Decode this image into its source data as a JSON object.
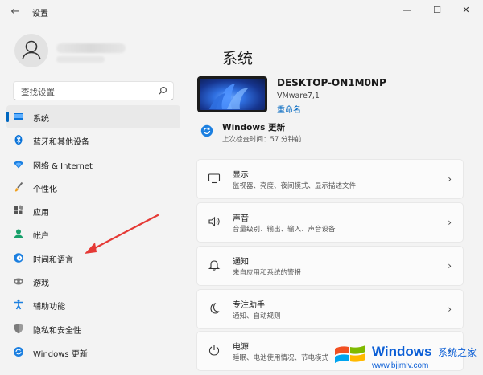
{
  "window": {
    "back_glyph": "←",
    "title": "设置",
    "controls": [
      "—",
      "☐",
      "✕"
    ]
  },
  "search": {
    "placeholder": "查找设置"
  },
  "sidebar": {
    "items": [
      {
        "label": "系统",
        "icon": "monitor-icon",
        "active": true
      },
      {
        "label": "蓝牙和其他设备",
        "icon": "bluetooth-icon"
      },
      {
        "label": "网络 & Internet",
        "icon": "wifi-icon"
      },
      {
        "label": "个性化",
        "icon": "brush-icon"
      },
      {
        "label": "应用",
        "icon": "apps-icon"
      },
      {
        "label": "帐户",
        "icon": "person-icon"
      },
      {
        "label": "时间和语言",
        "icon": "globe-clock-icon"
      },
      {
        "label": "游戏",
        "icon": "gamepad-icon"
      },
      {
        "label": "辅助功能",
        "icon": "accessibility-icon"
      },
      {
        "label": "隐私和安全性",
        "icon": "shield-icon"
      },
      {
        "label": "Windows 更新",
        "icon": "update-icon"
      }
    ]
  },
  "main": {
    "title": "系统",
    "device": {
      "name": "DESKTOP-ON1M0NP",
      "model": "VMware7,1",
      "rename": "重命名"
    },
    "update": {
      "title": "Windows 更新",
      "subtitle": "上次检查时间：57 分钟前"
    },
    "cards": [
      {
        "title": "显示",
        "desc": "监视器、亮度、夜间模式、显示描述文件",
        "icon": "display-icon"
      },
      {
        "title": "声音",
        "desc": "音量级别、输出、输入、声音设备",
        "icon": "speaker-icon"
      },
      {
        "title": "通知",
        "desc": "来自应用和系统的警报",
        "icon": "bell-icon"
      },
      {
        "title": "专注助手",
        "desc": "通知、自动规则",
        "icon": "moon-icon"
      },
      {
        "title": "电源",
        "desc": "睡眠、电池使用情况、节电模式",
        "icon": "power-icon"
      }
    ],
    "chevron": "›"
  },
  "watermark": {
    "brand": "Windows",
    "cn": "系统之家",
    "url": "www.bjjmlv.com"
  },
  "colors": {
    "accent": "#0067c0",
    "annotation_arrow": "#e53935"
  }
}
